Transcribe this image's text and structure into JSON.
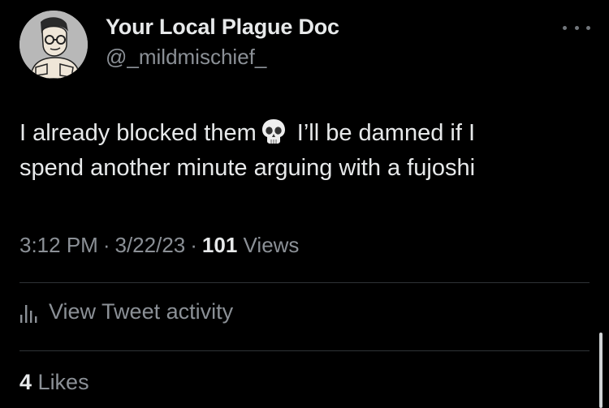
{
  "user": {
    "display_name": "Your Local Plague Doc",
    "handle": "@_mildmischief_",
    "avatar_icon": "cartoon-doctor-avatar"
  },
  "more_icon": "ellipsis-icon",
  "tweet": {
    "text_line1_before_emoji": "I already blocked them",
    "emoji": "skull",
    "text_line1_after_emoji": "I’ll be damned if I",
    "text_line2": "spend another minute arguing with a fujoshi"
  },
  "meta": {
    "time": "3:12 PM",
    "separator": "·",
    "date": "3/22/23",
    "views_count": "101",
    "views_label": "Views"
  },
  "activity": {
    "icon": "analytics-icon",
    "label": "View Tweet activity"
  },
  "likes": {
    "count": "4",
    "label": "Likes"
  },
  "colors": {
    "background": "#000000",
    "primary_text": "#e7e9ea",
    "secondary_text": "#8b9096",
    "divider": "#2f3336"
  }
}
